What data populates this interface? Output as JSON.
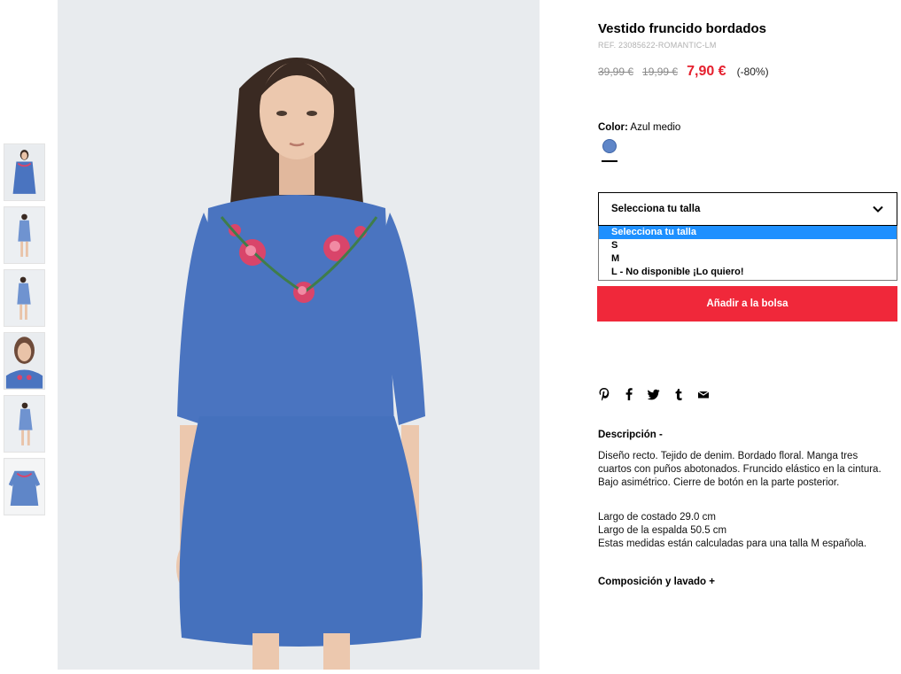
{
  "product": {
    "title": "Vestido fruncido bordados",
    "ref": "REF. 23085622-ROMANTIC-LM",
    "prices": {
      "original": "39,99 €",
      "previous": "19,99 €",
      "current": "7,90 €",
      "discount": "(-80%)"
    },
    "color": {
      "label": "Color:",
      "value": "Azul medio",
      "swatch_hex": "#5f86c8"
    }
  },
  "size_select": {
    "selected": "Selecciona tu talla",
    "options": [
      "Selecciona tu talla",
      "S",
      "M",
      "L - No disponible ¡Lo quiero!"
    ]
  },
  "add_to_bag": "Añadir a la bolsa",
  "share_icons": [
    "pinterest-icon",
    "facebook-icon",
    "twitter-icon",
    "tumblr-icon",
    "mail-icon"
  ],
  "description": {
    "title": "Descripción -",
    "text": "Diseño recto. Tejido de denim. Bordado floral. Manga tres cuartos con puños abotonados. Fruncido elástico en la cintura. Bajo asimétrico. Cierre de botón en la parte posterior.",
    "measures": [
      "Largo de costado 29.0 cm",
      "Largo de la espalda 50.5 cm",
      "Estas medidas están calculadas para una talla M española."
    ]
  },
  "composition": {
    "title": "Composición y lavado +"
  },
  "colors": {
    "accent_red": "#f0283a",
    "price_red": "#e5202e",
    "dress_blue": "#4a74c0",
    "dropdown_highlight": "#1e90ff"
  }
}
